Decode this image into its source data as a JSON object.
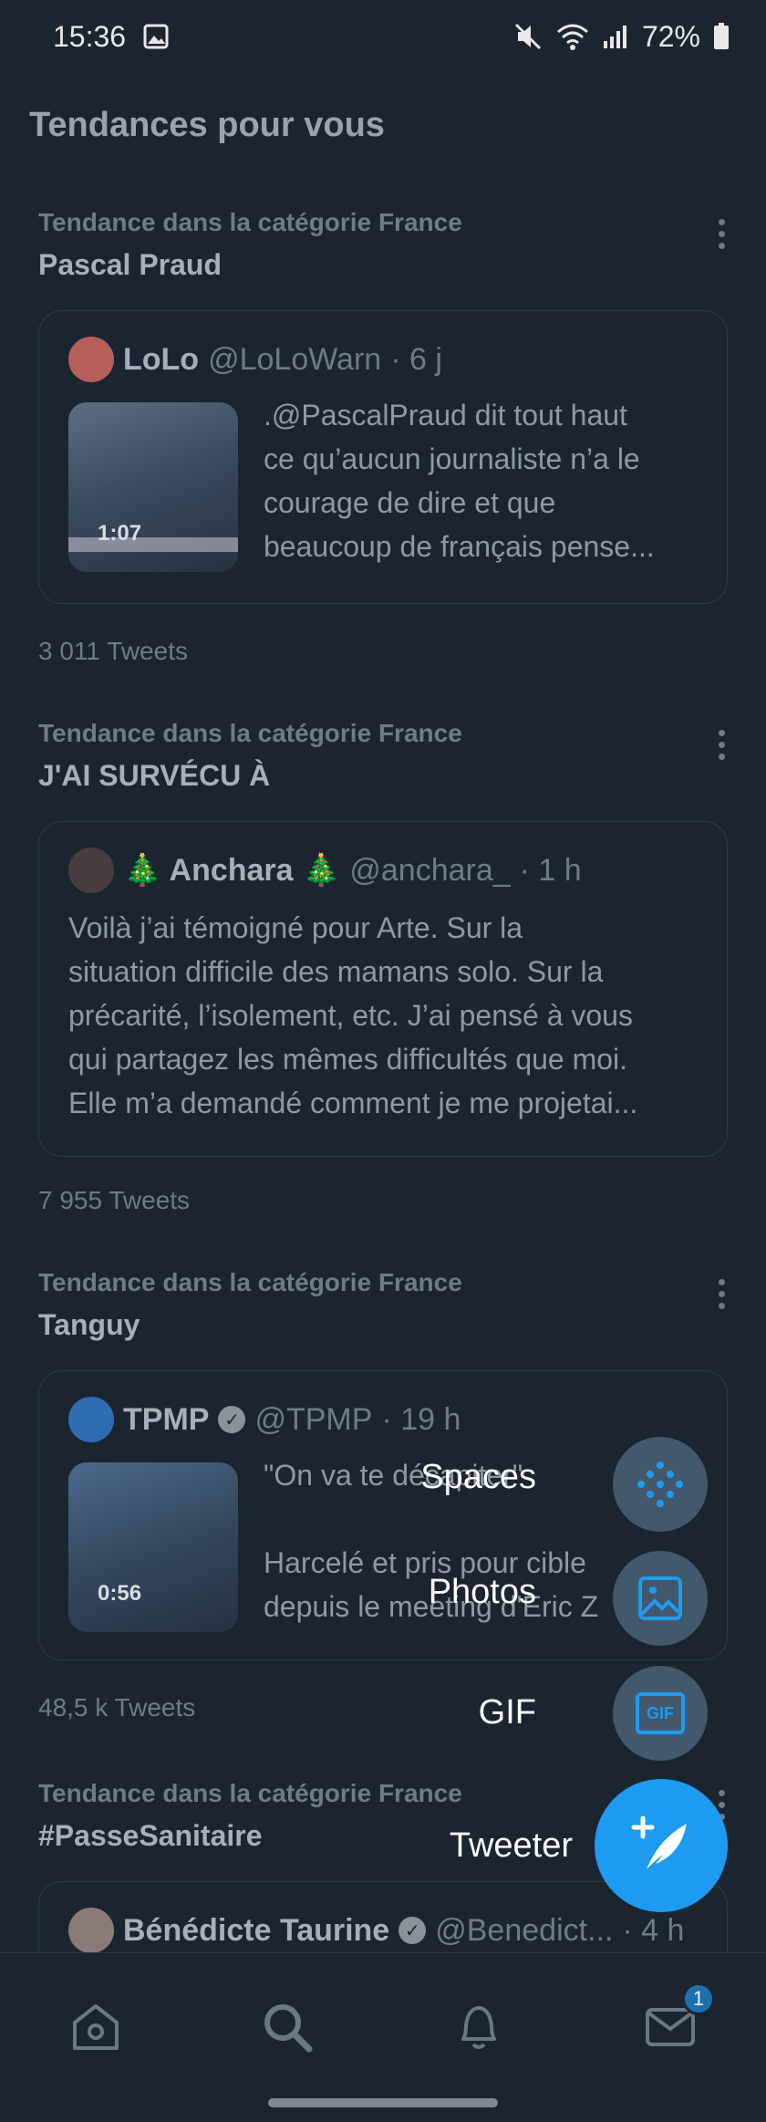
{
  "status": {
    "time": "15:36",
    "battery": "72%"
  },
  "section_title": "Tendances pour vous",
  "trends": [
    {
      "category": "Tendance dans la catégorie France",
      "name": "Pascal Praud",
      "tweet": {
        "user": "LoLo",
        "handle": "@LoLoWarn",
        "time": "· 6 j",
        "text_lines": [
          ".@PascalPraud dit tout haut",
          "ce qu’aucun journaliste n’a le",
          "courage de dire et que",
          "beaucoup de français pense..."
        ],
        "video_duration": "1:07"
      },
      "count": "3 011 Tweets"
    },
    {
      "category": "Tendance dans la catégorie France",
      "name": "J'AI SURVÉCU À",
      "tweet": {
        "user": "🎄 Anchara 🎄",
        "handle": "@anchara_",
        "time": "· 1 h",
        "text_lines": [
          "Voilà j’ai témoigné pour Arte. Sur la",
          "situation difficile des mamans solo. Sur la",
          "précarité, l’isolement, etc. J’ai pensé à vous",
          "qui partagez les mêmes difficultés que moi.",
          "Elle m’a demandé comment je me projetai..."
        ]
      },
      "count": "7 955 Tweets"
    },
    {
      "category": "Tendance dans la catégorie France",
      "name": "Tanguy",
      "tweet": {
        "user": "TPMP",
        "handle": "@TPMP",
        "time": "· 19 h",
        "text_lines": [
          "\"On va te décapiter\"",
          "",
          "Harcelé et pris pour cible",
          "depuis le meeting d'Eric Z"
        ],
        "video_duration": "0:56"
      },
      "count": "48,5 k Tweets"
    },
    {
      "category": "Tendance dans la catégorie France",
      "name": "#PasseSanitaire",
      "tweet": {
        "user": "Bénédicte Taurine",
        "handle": "@Benedict...",
        "time": "· 4 h"
      }
    }
  ],
  "fab_menu": {
    "spaces": "Spaces",
    "photos": "Photos",
    "gif": "GIF",
    "tweet": "Tweeter",
    "gif_icon_text": "GIF"
  },
  "nav": {
    "messages_badge": "1"
  },
  "colors": {
    "accent": "#1d9bf0",
    "background": "#15202b"
  }
}
